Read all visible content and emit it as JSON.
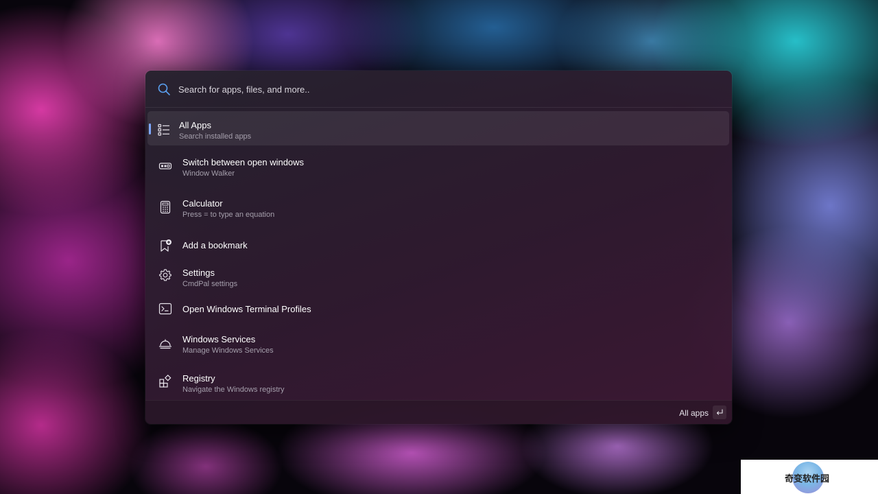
{
  "search": {
    "placeholder": "Search for apps, files, and more.."
  },
  "items": [
    {
      "title": "All Apps",
      "subtitle": "Search installed apps",
      "icon": "list-icon",
      "selected": true
    },
    {
      "title": "Switch between open windows",
      "subtitle": "Window Walker",
      "icon": "window-switch-icon"
    },
    {
      "title": "Calculator",
      "subtitle": "Press = to type an equation",
      "icon": "calculator-icon"
    },
    {
      "title": "Add a bookmark",
      "subtitle": "",
      "icon": "bookmark-add-icon"
    },
    {
      "title": "Settings",
      "subtitle": "CmdPal settings",
      "icon": "gear-icon"
    },
    {
      "title": "Open Windows Terminal Profiles",
      "subtitle": "",
      "icon": "terminal-icon"
    },
    {
      "title": "Windows Services",
      "subtitle": "Manage Windows Services",
      "icon": "services-icon"
    },
    {
      "title": "Registry",
      "subtitle": "Navigate the Windows registry",
      "icon": "registry-icon"
    }
  ],
  "footer": {
    "action_label": "All apps",
    "key_icon": "enter-key-icon"
  },
  "watermark": {
    "text": "奇变软件园"
  },
  "colors": {
    "accent": "#7fa8ff",
    "panel": "#2b2230",
    "text": "#ffffff",
    "subtext": "#a59fac"
  }
}
